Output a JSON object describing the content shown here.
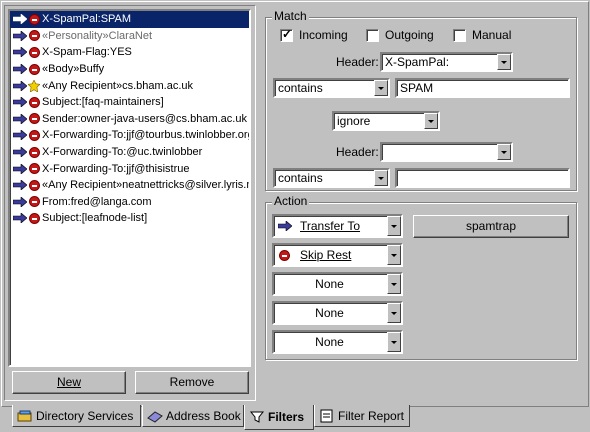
{
  "filters": [
    {
      "text": "X-SpamPal:SPAM",
      "selected": true,
      "icon": "arrow"
    },
    {
      "text": "«Personality»ClaraNet",
      "dim": true,
      "icon": "stop"
    },
    {
      "text": "X-Spam-Flag:YES",
      "icon": "stop"
    },
    {
      "text": "«Body»Buffy",
      "icon": "stop"
    },
    {
      "text": "«Any Recipient»cs.bham.ac.uk",
      "icon": "star"
    },
    {
      "text": "Subject:[faq-maintainers]",
      "icon": "stop"
    },
    {
      "text": "Sender:owner-java-users@cs.bham.ac.uk",
      "icon": "stop"
    },
    {
      "text": "X-Forwarding-To:jjf@tourbus.twinlobber.org",
      "icon": "stop"
    },
    {
      "text": "X-Forwarding-To:@uc.twinlobber",
      "icon": "stop"
    },
    {
      "text": "X-Forwarding-To:jjf@thisistrue",
      "icon": "stop"
    },
    {
      "text": "«Any Recipient»neatnettricks@silver.lyris.n",
      "icon": "stop"
    },
    {
      "text": "From:fred@langa.com",
      "icon": "stop"
    },
    {
      "text": "Subject:[leafnode-list]",
      "icon": "stop"
    }
  ],
  "buttons": {
    "new": "New",
    "remove": "Remove"
  },
  "match": {
    "title": "Match",
    "incoming": "Incoming",
    "outgoing": "Outgoing",
    "manual": "Manual",
    "header_label_1": "Header:",
    "header_value_1": "X-SpamPal:",
    "op_1": "contains",
    "value_1": "SPAM",
    "logic": "ignore",
    "header_label_2": "Header:",
    "header_value_2": "",
    "op_2": "contains",
    "value_2": ""
  },
  "action": {
    "title": "Action",
    "a1": "Transfer To",
    "a2": "Skip Rest",
    "a3": "None",
    "a4": "None",
    "a5": "None",
    "mailbox": "spamtrap"
  },
  "tabs": [
    "Directory Services",
    "Address Book",
    "Filters",
    "Filter Report"
  ]
}
